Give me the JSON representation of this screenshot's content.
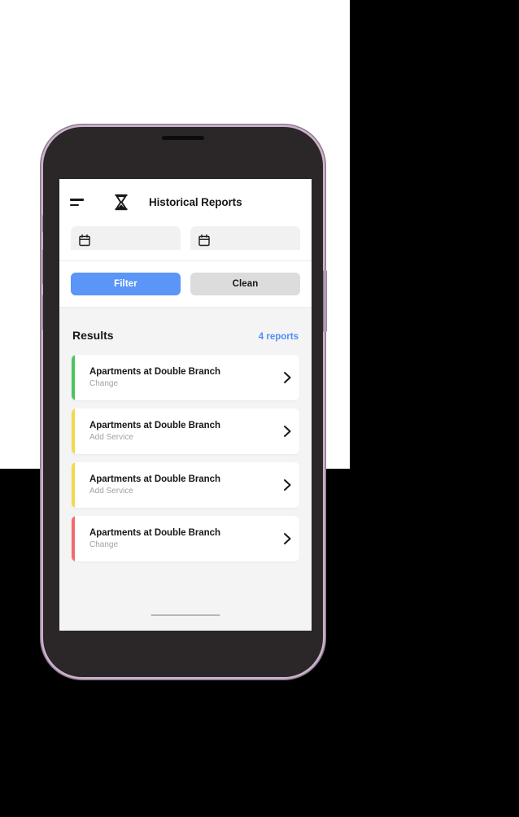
{
  "app": {
    "title": "Historical Reports",
    "menu_icon": "hamburger-icon",
    "brand_icon": "hourglass-icon"
  },
  "filters": {
    "start_date": {
      "icon": "calendar-icon",
      "value": "",
      "placeholder": ""
    },
    "end_date": {
      "icon": "calendar-icon",
      "value": "",
      "placeholder": ""
    },
    "filter_button": "Filter",
    "clean_button": "Clean"
  },
  "results": {
    "heading": "Results",
    "count_label": "4 reports",
    "items": [
      {
        "title": "Apartments at Double Branch",
        "subtitle": "Change",
        "accent": "#4CC55E",
        "chevron": "chevron-right-icon"
      },
      {
        "title": "Apartments at Double Branch",
        "subtitle": "Add Service",
        "accent": "#F2D94E",
        "chevron": "chevron-right-icon"
      },
      {
        "title": "Apartments at Double Branch",
        "subtitle": "Add Service",
        "accent": "#F2D94E",
        "chevron": "chevron-right-icon"
      },
      {
        "title": "Apartments at Double Branch",
        "subtitle": "Change",
        "accent": "#F26C70",
        "chevron": "chevron-right-icon"
      }
    ]
  },
  "colors": {
    "primary": "#5B95F7",
    "link": "#4D8DF6",
    "secondary_button": "#DCDCDD",
    "screen_background": "#F4F4F5",
    "card_background": "#FFFFFF",
    "text_primary": "#18181B",
    "text_muted": "#A1A1AA"
  },
  "device": {
    "home_indicator": "home-indicator",
    "buttons": [
      "silent-switch",
      "volume-up-button",
      "volume-down-button",
      "power-button"
    ]
  }
}
